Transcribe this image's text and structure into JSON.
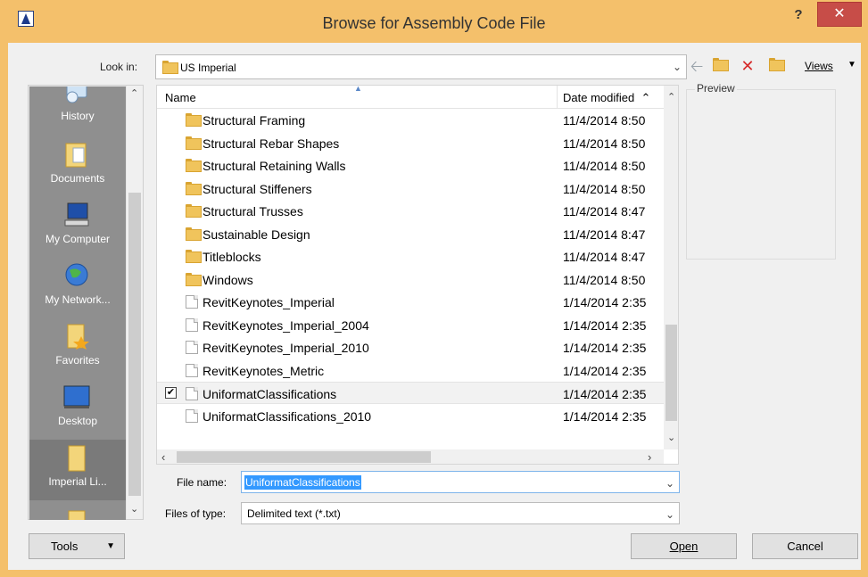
{
  "window": {
    "title": "Browse for Assembly Code File",
    "help_label": "?",
    "close_label": "✕"
  },
  "toolbar": {
    "look_in_label": "Look in:",
    "look_in_value": "US Imperial",
    "views_label": "Views"
  },
  "places": [
    {
      "label": "History",
      "icon": "history-icon"
    },
    {
      "label": "Documents",
      "icon": "documents-icon"
    },
    {
      "label": "My Computer",
      "icon": "my-computer-icon"
    },
    {
      "label": "My Network...",
      "icon": "network-icon"
    },
    {
      "label": "Favorites",
      "icon": "favorites-icon"
    },
    {
      "label": "Desktop",
      "icon": "desktop-icon"
    },
    {
      "label": "Imperial Li...",
      "icon": "folder-icon"
    }
  ],
  "filelist": {
    "col_name": "Name",
    "col_date": "Date modified",
    "rows": [
      {
        "name": "Structural Framing",
        "date": "11/4/2014 8:50",
        "type": "folder"
      },
      {
        "name": "Structural Rebar Shapes",
        "date": "11/4/2014 8:50",
        "type": "folder"
      },
      {
        "name": "Structural Retaining Walls",
        "date": "11/4/2014 8:50",
        "type": "folder"
      },
      {
        "name": "Structural Stiffeners",
        "date": "11/4/2014 8:50",
        "type": "folder"
      },
      {
        "name": "Structural Trusses",
        "date": "11/4/2014 8:47",
        "type": "folder"
      },
      {
        "name": "Sustainable Design",
        "date": "11/4/2014 8:47",
        "type": "folder"
      },
      {
        "name": "Titleblocks",
        "date": "11/4/2014 8:47",
        "type": "folder"
      },
      {
        "name": "Windows",
        "date": "11/4/2014 8:50",
        "type": "folder"
      },
      {
        "name": "RevitKeynotes_Imperial",
        "date": "1/14/2014 2:35",
        "type": "file"
      },
      {
        "name": "RevitKeynotes_Imperial_2004",
        "date": "1/14/2014 2:35",
        "type": "file"
      },
      {
        "name": "RevitKeynotes_Imperial_2010",
        "date": "1/14/2014 2:35",
        "type": "file"
      },
      {
        "name": "RevitKeynotes_Metric",
        "date": "1/14/2014 2:35",
        "type": "file"
      },
      {
        "name": "UniformatClassifications",
        "date": "1/14/2014 2:35",
        "type": "file",
        "checked": true
      },
      {
        "name": "UniformatClassifications_2010",
        "date": "1/14/2014 2:35",
        "type": "file"
      }
    ]
  },
  "preview": {
    "label": "Preview"
  },
  "file_name": {
    "label": "File name:",
    "value": "UniformatClassifications"
  },
  "file_type": {
    "label": "Files of type:",
    "value": "Delimited text (*.txt)"
  },
  "buttons": {
    "tools": "Tools",
    "open": "Open",
    "cancel": "Cancel"
  }
}
